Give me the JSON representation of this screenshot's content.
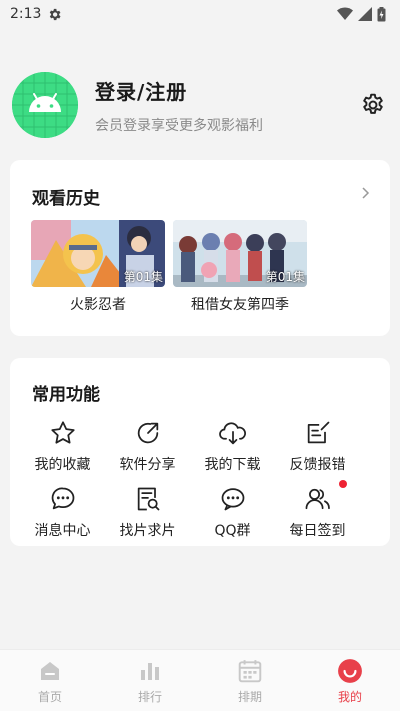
{
  "status_bar": {
    "time": "2:13"
  },
  "profile": {
    "title": "登录/注册",
    "subtitle": "会员登录享受更多观影福利"
  },
  "history": {
    "title": "观看历史",
    "items": [
      {
        "name": "火影忍者",
        "episode": "第01集"
      },
      {
        "name": "租借女友第四季",
        "episode": "第01集"
      }
    ]
  },
  "functions": {
    "title": "常用功能",
    "items": [
      {
        "label": "我的收藏",
        "icon": "star-icon"
      },
      {
        "label": "软件分享",
        "icon": "share-icon"
      },
      {
        "label": "我的下载",
        "icon": "cloud-download-icon"
      },
      {
        "label": "反馈报错",
        "icon": "feedback-edit-icon"
      },
      {
        "label": "消息中心",
        "icon": "message-icon"
      },
      {
        "label": "找片求片",
        "icon": "search-document-icon"
      },
      {
        "label": "QQ群",
        "icon": "chat-group-icon"
      },
      {
        "label": "每日签到",
        "icon": "users-icon"
      }
    ]
  },
  "nav": {
    "items": [
      {
        "label": "首页",
        "icon": "home-icon"
      },
      {
        "label": "排行",
        "icon": "chart-icon"
      },
      {
        "label": "排期",
        "icon": "calendar-icon"
      },
      {
        "label": "我的",
        "icon": "smile-icon"
      }
    ],
    "active_index": 3
  },
  "colors": {
    "accent": "#e8404a",
    "avatar_bg": "#3ddc84",
    "nav_inactive": "#aaaaaa"
  }
}
